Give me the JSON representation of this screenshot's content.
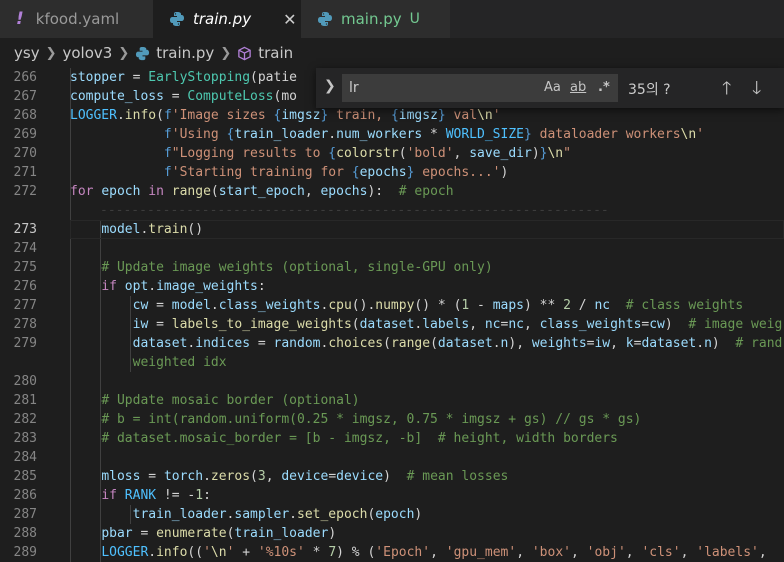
{
  "tabs": [
    {
      "label": "kfood.yaml",
      "icon": "!"
    },
    {
      "label": "train.py",
      "close": "✕"
    },
    {
      "label": "main.py",
      "badge": "U"
    }
  ],
  "breadcrumb": {
    "folder1": "ysy",
    "folder2": "yolov3",
    "file": "train.py",
    "symbol": "train"
  },
  "find": {
    "value": "lr",
    "match_case": "Aa",
    "whole_word": "ab",
    "regex": ".*",
    "result": "35의 ?"
  },
  "lines": [
    {
      "n": "266",
      "tokens": [
        [
          "var",
          "stopper"
        ],
        [
          "op",
          " = "
        ],
        [
          "cls",
          "EarlyStopping"
        ],
        [
          "pl",
          "(patie"
        ]
      ]
    },
    {
      "n": "267",
      "tokens": [
        [
          "var",
          "compute_loss"
        ],
        [
          "op",
          " = "
        ],
        [
          "cls",
          "ComputeLoss"
        ],
        [
          "pl",
          "(mo"
        ]
      ]
    },
    {
      "n": "268",
      "tokens": [
        [
          "cst",
          "LOGGER"
        ],
        [
          "pl",
          "."
        ],
        [
          "fn",
          "info"
        ],
        [
          "pl",
          "("
        ],
        [
          "kwb",
          "f"
        ],
        [
          "str",
          "'Image sizes "
        ],
        [
          "kwb",
          "{"
        ],
        [
          "var",
          "imgsz"
        ],
        [
          "kwb",
          "}"
        ],
        [
          "str",
          " train, "
        ],
        [
          "kwb",
          "{"
        ],
        [
          "var",
          "imgsz"
        ],
        [
          "kwb",
          "}"
        ],
        [
          "str",
          " val"
        ],
        [
          "fn",
          "\\n"
        ],
        [
          "str",
          "'"
        ]
      ]
    },
    {
      "n": "269",
      "tokens": [
        [
          "pl",
          "            "
        ],
        [
          "kwb",
          "f"
        ],
        [
          "str",
          "'Using "
        ],
        [
          "kwb",
          "{"
        ],
        [
          "var",
          "train_loader"
        ],
        [
          "pl",
          "."
        ],
        [
          "var",
          "num_workers"
        ],
        [
          "op",
          " * "
        ],
        [
          "cst",
          "WORLD_SIZE"
        ],
        [
          "kwb",
          "}"
        ],
        [
          "str",
          " dataloader workers"
        ],
        [
          "fn",
          "\\n"
        ],
        [
          "str",
          "'"
        ]
      ]
    },
    {
      "n": "270",
      "tokens": [
        [
          "pl",
          "            "
        ],
        [
          "kwb",
          "f"
        ],
        [
          "str",
          "\"Logging results to "
        ],
        [
          "kwb",
          "{"
        ],
        [
          "fn",
          "colorstr"
        ],
        [
          "pl",
          "("
        ],
        [
          "str",
          "'bold'"
        ],
        [
          "pl",
          ", "
        ],
        [
          "var",
          "save_dir"
        ],
        [
          "pl",
          ")"
        ],
        [
          "kwb",
          "}"
        ],
        [
          "fn",
          "\\n"
        ],
        [
          "str",
          "\""
        ]
      ]
    },
    {
      "n": "271",
      "tokens": [
        [
          "pl",
          "            "
        ],
        [
          "kwb",
          "f"
        ],
        [
          "str",
          "'Starting training for "
        ],
        [
          "kwb",
          "{"
        ],
        [
          "var",
          "epochs"
        ],
        [
          "kwb",
          "}"
        ],
        [
          "str",
          " epochs...'"
        ],
        [
          "pl",
          ")"
        ]
      ]
    },
    {
      "n": "272",
      "tokens": [
        [
          "kw",
          "for"
        ],
        [
          "pl",
          " "
        ],
        [
          "var",
          "epoch"
        ],
        [
          "pl",
          " "
        ],
        [
          "kw",
          "in"
        ],
        [
          "pl",
          " "
        ],
        [
          "fn",
          "range"
        ],
        [
          "pl",
          "("
        ],
        [
          "var",
          "start_epoch"
        ],
        [
          "pl",
          ", "
        ],
        [
          "var",
          "epochs"
        ],
        [
          "pl",
          "):  "
        ],
        [
          "com",
          "# epoch"
        ]
      ]
    },
    {
      "n": "",
      "tokens": []
    },
    {
      "n": "273",
      "current": true,
      "tokens": [
        [
          "pl",
          "    "
        ],
        [
          "var",
          "model"
        ],
        [
          "pl",
          "."
        ],
        [
          "fn",
          "train"
        ],
        [
          "pl",
          "()"
        ]
      ]
    },
    {
      "n": "274",
      "tokens": []
    },
    {
      "n": "275",
      "tokens": [
        [
          "pl",
          "    "
        ],
        [
          "com",
          "# Update image weights (optional, single-GPU only)"
        ]
      ]
    },
    {
      "n": "276",
      "tokens": [
        [
          "pl",
          "    "
        ],
        [
          "kw",
          "if"
        ],
        [
          "pl",
          " "
        ],
        [
          "var",
          "opt"
        ],
        [
          "pl",
          "."
        ],
        [
          "var",
          "image_weights"
        ],
        [
          "pl",
          ":"
        ]
      ]
    },
    {
      "n": "277",
      "tokens": [
        [
          "pl",
          "        "
        ],
        [
          "var",
          "cw"
        ],
        [
          "op",
          " = "
        ],
        [
          "var",
          "model"
        ],
        [
          "pl",
          "."
        ],
        [
          "var",
          "class_weights"
        ],
        [
          "pl",
          "."
        ],
        [
          "fn",
          "cpu"
        ],
        [
          "pl",
          "()."
        ],
        [
          "fn",
          "numpy"
        ],
        [
          "pl",
          "()"
        ],
        [
          "op",
          " * "
        ],
        [
          "pl",
          "("
        ],
        [
          "num",
          "1"
        ],
        [
          "op",
          " - "
        ],
        [
          "var",
          "maps"
        ],
        [
          "pl",
          ")"
        ],
        [
          "op",
          " ** "
        ],
        [
          "num",
          "2"
        ],
        [
          "op",
          " / "
        ],
        [
          "var",
          "nc"
        ],
        [
          "pl",
          "  "
        ],
        [
          "com",
          "# class weights"
        ]
      ]
    },
    {
      "n": "278",
      "tokens": [
        [
          "pl",
          "        "
        ],
        [
          "var",
          "iw"
        ],
        [
          "op",
          " = "
        ],
        [
          "fn",
          "labels_to_image_weights"
        ],
        [
          "pl",
          "("
        ],
        [
          "var",
          "dataset"
        ],
        [
          "pl",
          "."
        ],
        [
          "var",
          "labels"
        ],
        [
          "pl",
          ", "
        ],
        [
          "var",
          "nc"
        ],
        [
          "op",
          "="
        ],
        [
          "var",
          "nc"
        ],
        [
          "pl",
          ", "
        ],
        [
          "var",
          "class_weights"
        ],
        [
          "op",
          "="
        ],
        [
          "var",
          "cw"
        ],
        [
          "pl",
          ")  "
        ],
        [
          "com",
          "# image weig"
        ]
      ]
    },
    {
      "n": "279",
      "tokens": [
        [
          "pl",
          "        "
        ],
        [
          "var",
          "dataset"
        ],
        [
          "pl",
          "."
        ],
        [
          "var",
          "indices"
        ],
        [
          "op",
          " = "
        ],
        [
          "var",
          "random"
        ],
        [
          "pl",
          "."
        ],
        [
          "fn",
          "choices"
        ],
        [
          "pl",
          "("
        ],
        [
          "fn",
          "range"
        ],
        [
          "pl",
          "("
        ],
        [
          "var",
          "dataset"
        ],
        [
          "pl",
          "."
        ],
        [
          "var",
          "n"
        ],
        [
          "pl",
          "), "
        ],
        [
          "var",
          "weights"
        ],
        [
          "op",
          "="
        ],
        [
          "var",
          "iw"
        ],
        [
          "pl",
          ", "
        ],
        [
          "var",
          "k"
        ],
        [
          "op",
          "="
        ],
        [
          "var",
          "dataset"
        ],
        [
          "pl",
          "."
        ],
        [
          "var",
          "n"
        ],
        [
          "pl",
          ")  "
        ],
        [
          "com",
          "# rand"
        ]
      ]
    },
    {
      "n": "",
      "tokens": [
        [
          "pl",
          "        "
        ],
        [
          "com",
          "weighted idx"
        ]
      ]
    },
    {
      "n": "280",
      "tokens": []
    },
    {
      "n": "281",
      "tokens": [
        [
          "pl",
          "    "
        ],
        [
          "com",
          "# Update mosaic border (optional)"
        ]
      ]
    },
    {
      "n": "282",
      "tokens": [
        [
          "pl",
          "    "
        ],
        [
          "com",
          "# b = int(random.uniform(0.25 * imgsz, 0.75 * imgsz + gs) // gs * gs)"
        ]
      ]
    },
    {
      "n": "283",
      "tokens": [
        [
          "pl",
          "    "
        ],
        [
          "com",
          "# dataset.mosaic_border = [b - imgsz, -b]  # height, width borders"
        ]
      ]
    },
    {
      "n": "284",
      "tokens": []
    },
    {
      "n": "285",
      "tokens": [
        [
          "pl",
          "    "
        ],
        [
          "var",
          "mloss"
        ],
        [
          "op",
          " = "
        ],
        [
          "var",
          "torch"
        ],
        [
          "pl",
          "."
        ],
        [
          "fn",
          "zeros"
        ],
        [
          "pl",
          "("
        ],
        [
          "num",
          "3"
        ],
        [
          "pl",
          ", "
        ],
        [
          "var",
          "device"
        ],
        [
          "op",
          "="
        ],
        [
          "var",
          "device"
        ],
        [
          "pl",
          ")  "
        ],
        [
          "com",
          "# mean losses"
        ]
      ]
    },
    {
      "n": "286",
      "tokens": [
        [
          "pl",
          "    "
        ],
        [
          "kw",
          "if"
        ],
        [
          "pl",
          " "
        ],
        [
          "cst",
          "RANK"
        ],
        [
          "op",
          " != "
        ],
        [
          "op",
          "-"
        ],
        [
          "num",
          "1"
        ],
        [
          "pl",
          ":"
        ]
      ]
    },
    {
      "n": "287",
      "tokens": [
        [
          "pl",
          "        "
        ],
        [
          "var",
          "train_loader"
        ],
        [
          "pl",
          "."
        ],
        [
          "var",
          "sampler"
        ],
        [
          "pl",
          "."
        ],
        [
          "fn",
          "set_epoch"
        ],
        [
          "pl",
          "("
        ],
        [
          "var",
          "epoch"
        ],
        [
          "pl",
          ")"
        ]
      ]
    },
    {
      "n": "288",
      "tokens": [
        [
          "pl",
          "    "
        ],
        [
          "var",
          "pbar"
        ],
        [
          "op",
          " = "
        ],
        [
          "fn",
          "enumerate"
        ],
        [
          "pl",
          "("
        ],
        [
          "var",
          "train_loader"
        ],
        [
          "pl",
          ")"
        ]
      ]
    },
    {
      "n": "289",
      "tokens": [
        [
          "pl",
          "    "
        ],
        [
          "cst",
          "LOGGER"
        ],
        [
          "pl",
          "."
        ],
        [
          "fn",
          "info"
        ],
        [
          "pl",
          "(("
        ],
        [
          "str",
          "'"
        ],
        [
          "fn",
          "\\n"
        ],
        [
          "str",
          "'"
        ],
        [
          "op",
          " + "
        ],
        [
          "str",
          "'%10s'"
        ],
        [
          "op",
          " * "
        ],
        [
          "num",
          "7"
        ],
        [
          "pl",
          ")"
        ],
        [
          "op",
          " % "
        ],
        [
          "pl",
          "("
        ],
        [
          "str",
          "'Epoch'"
        ],
        [
          "pl",
          ", "
        ],
        [
          "str",
          "'gpu_mem'"
        ],
        [
          "pl",
          ", "
        ],
        [
          "str",
          "'box'"
        ],
        [
          "pl",
          ", "
        ],
        [
          "str",
          "'obj'"
        ],
        [
          "pl",
          ", "
        ],
        [
          "str",
          "'cls'"
        ],
        [
          "pl",
          ", "
        ],
        [
          "str",
          "'labels'"
        ],
        [
          "pl",
          ","
        ]
      ]
    }
  ]
}
